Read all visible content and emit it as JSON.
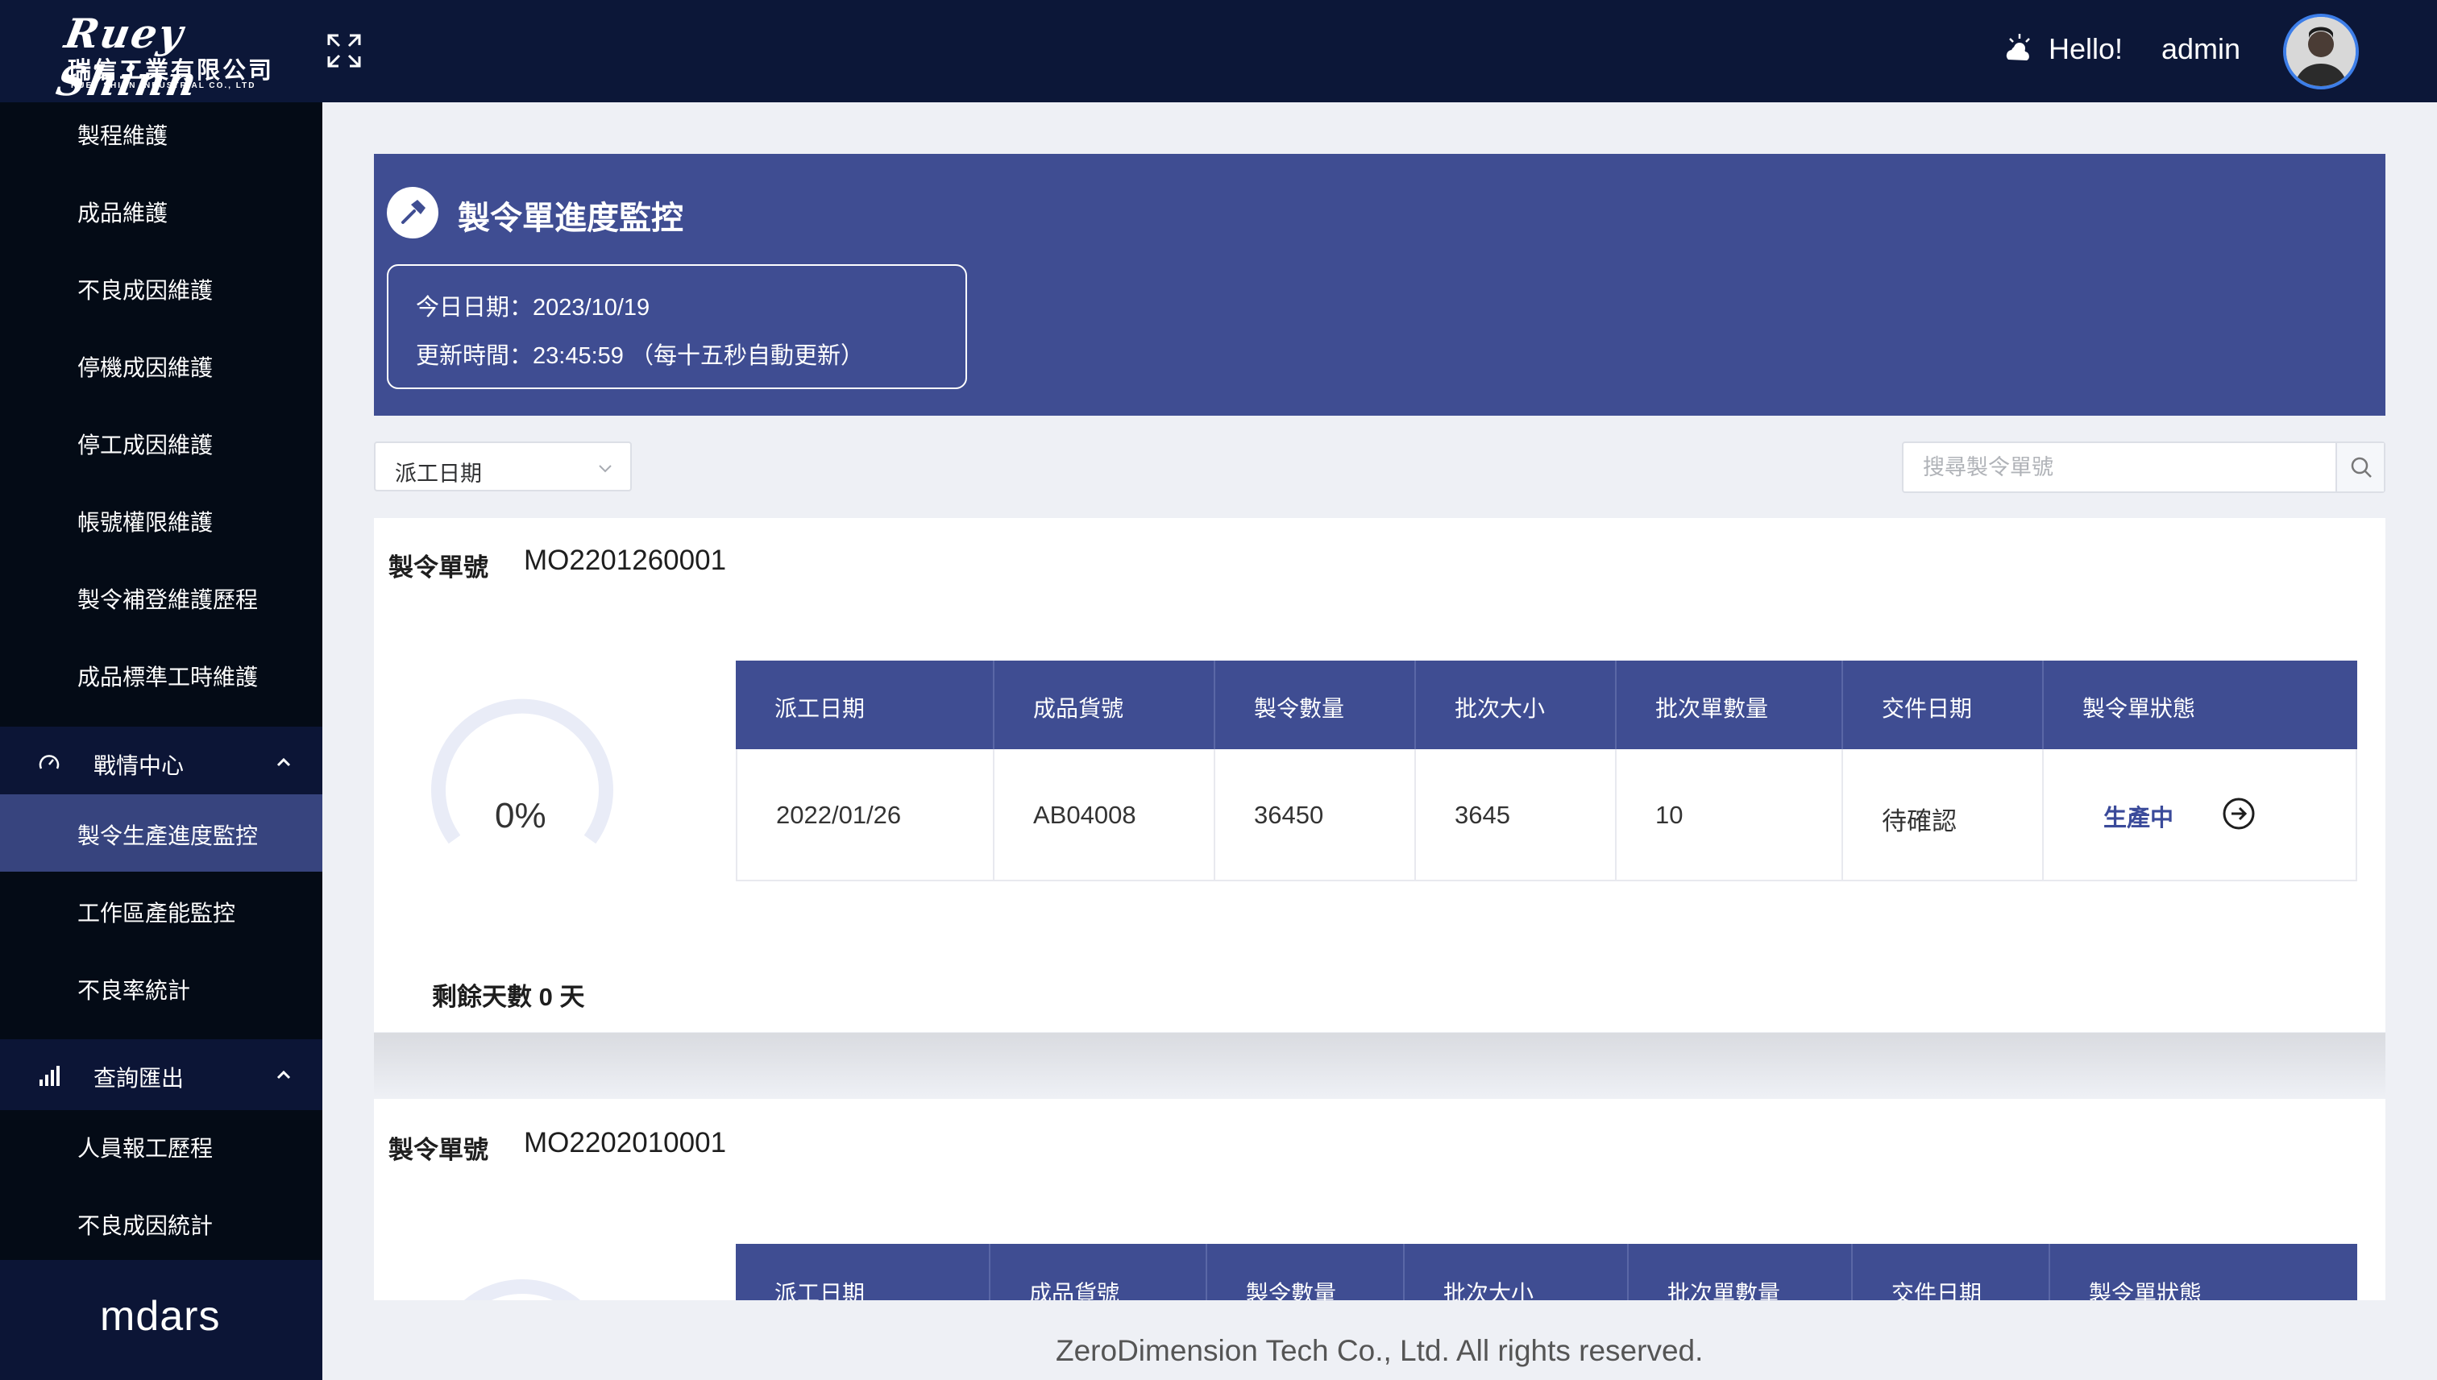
{
  "header": {
    "logo_script": "Ruey Shinn",
    "logo_cn": "瑞信工業有限公司",
    "logo_en": "RUEY SHINN INDUSTRIAL CO., LTD",
    "greeting": "Hello!",
    "user": "admin"
  },
  "sidebar": {
    "items": [
      {
        "label": "製程維護"
      },
      {
        "label": "成品維護"
      },
      {
        "label": "不良成因維護"
      },
      {
        "label": "停機成因維護"
      },
      {
        "label": "停工成因維護"
      },
      {
        "label": "帳號權限維護"
      },
      {
        "label": "製令補登維護歷程"
      },
      {
        "label": "成品標準工時維護"
      }
    ],
    "group1": {
      "label": "戰情中心",
      "items": [
        {
          "label": "製令生產進度監控"
        },
        {
          "label": "工作區產能監控"
        },
        {
          "label": "不良率統計"
        }
      ]
    },
    "group2": {
      "label": "查詢匯出",
      "items": [
        {
          "label": "人員報工歷程"
        },
        {
          "label": "不良成因統計"
        }
      ]
    },
    "brand": "mdars"
  },
  "hero": {
    "title": "製令單進度監控",
    "date_line": "今日日期：2023/10/19",
    "update_line": "更新時間：23:45:59 （每十五秒自動更新）"
  },
  "filter": {
    "sort_value": "派工日期",
    "search_placeholder": "搜尋製令單號"
  },
  "table_headers": [
    "派工日期",
    "成品貨號",
    "製令數量",
    "批次大小",
    "批次單數量",
    "交件日期",
    "製令單狀態"
  ],
  "orders": [
    {
      "label": "製令單號",
      "mo": "MO2201260001",
      "progress": "0%",
      "progress_fraction": 0,
      "days_left": "剩餘天數 0 天",
      "row": [
        "2022/01/26",
        "AB04008",
        "36450",
        "3645",
        "10",
        "待確認"
      ],
      "status": "生產中"
    },
    {
      "label": "製令單號",
      "mo": "MO2202010001"
    }
  ],
  "footer": {
    "copyright": "ZeroDimension Tech Co., Ltd. All rights reserved."
  },
  "colors": {
    "navy": "#0c1738",
    "accent": "#3f4d92",
    "sidebar": "#040b16",
    "active": "#37447e"
  }
}
